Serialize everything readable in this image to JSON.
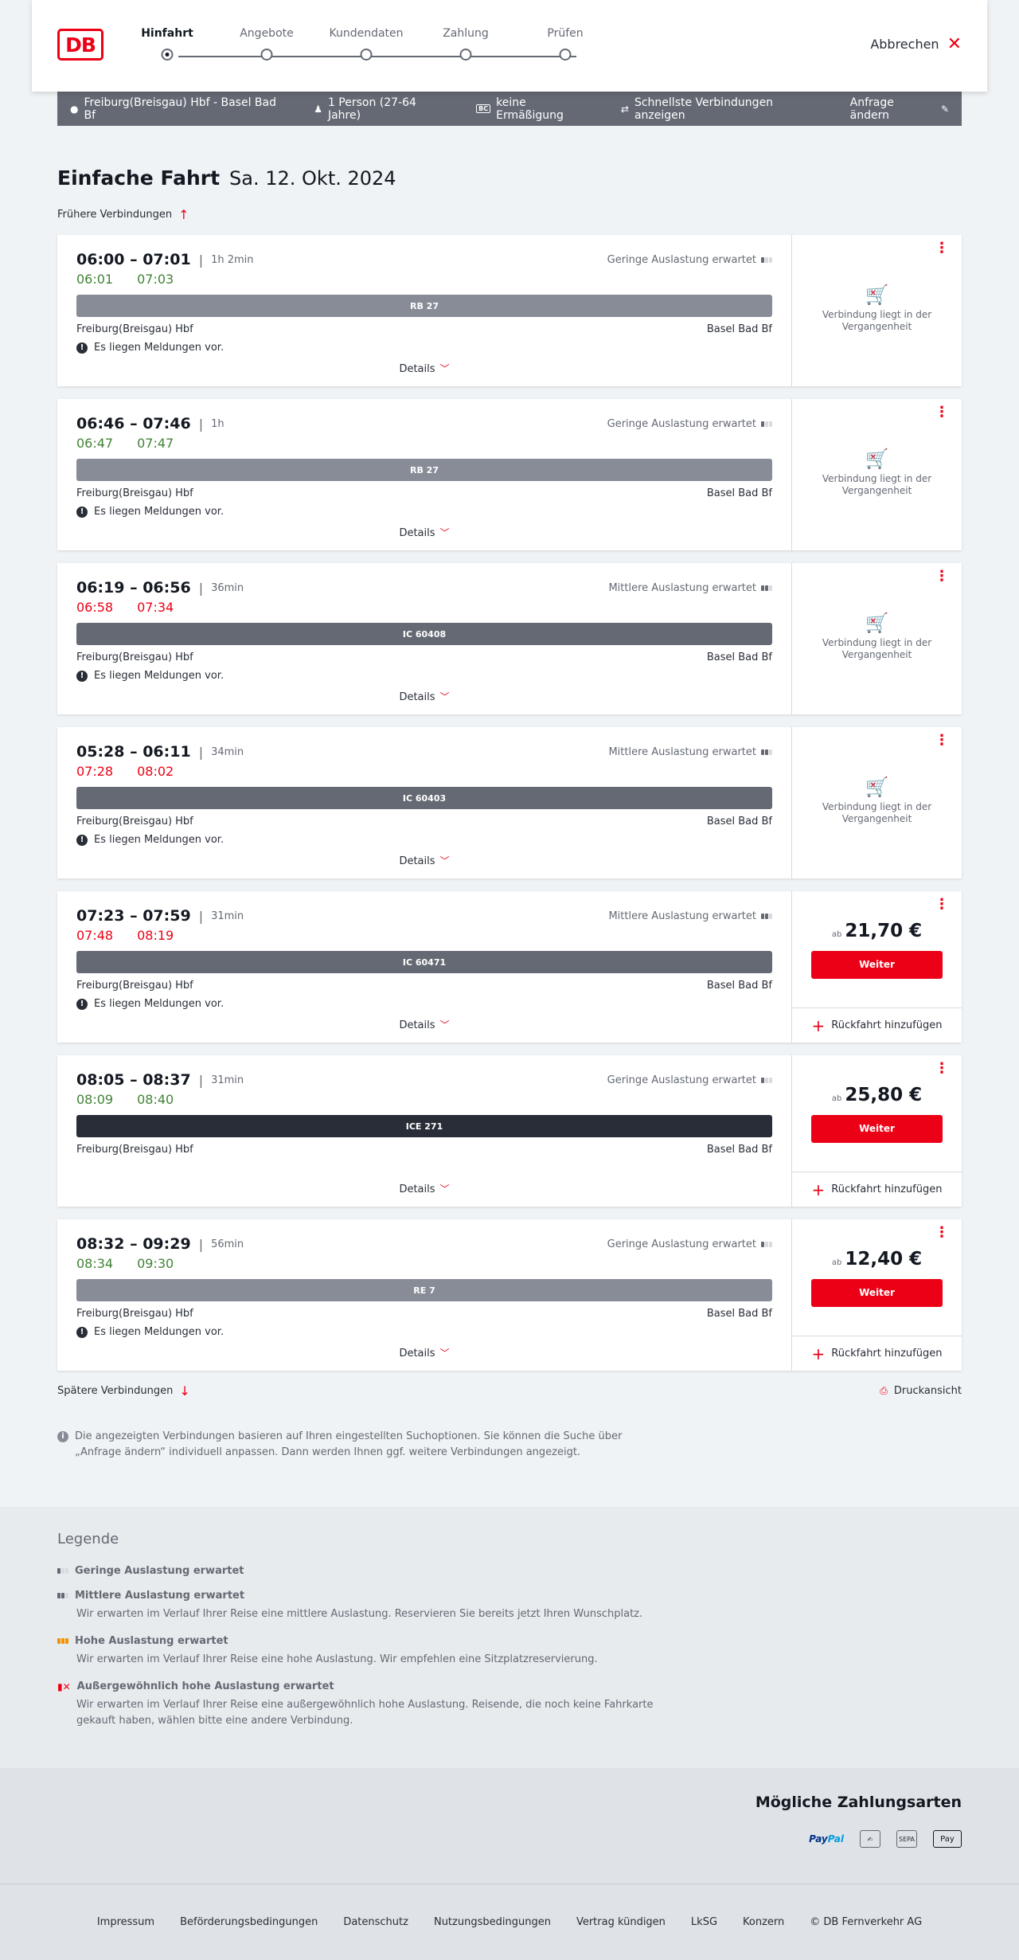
{
  "header": {
    "logo": "DB",
    "steps": [
      {
        "label": "Hinfahrt",
        "active": true
      },
      {
        "label": "Angebote",
        "active": false
      },
      {
        "label": "Kundendaten",
        "active": false
      },
      {
        "label": "Zahlung",
        "active": false
      },
      {
        "label": "Prüfen",
        "active": false
      }
    ],
    "cancel_label": "Abbrechen"
  },
  "searchbar": {
    "route": "Freiburg(Breisgau) Hbf - Basel Bad Bf",
    "persons": "1 Person (27-64 Jahre)",
    "discount_badge": "BC",
    "discount": "keine Ermäßigung",
    "fastest": "Schnellste Verbindungen anzeigen",
    "change": "Anfrage ändern"
  },
  "page": {
    "title": "Einfache Fahrt",
    "date": "Sa. 12. Okt. 2024",
    "earlier": "Frühere Verbindungen",
    "later": "Spätere Verbindungen",
    "print": "Druckansicht",
    "info": "Die angezeigten Verbindungen basieren auf Ihren eingestellten Suchoptionen. Sie können die Suche über „Anfrage ändern“ individuell anpassen. Dann werden Ihnen ggf. weitere Verbindungen angezeigt."
  },
  "connections": [
    {
      "times": "06:00 – 07:01",
      "duration": "1h 2min",
      "load": "Geringe Auslastung erwartet",
      "load_level": 1,
      "rt_dep": "06:01",
      "rt_arr": "07:03",
      "rt_status": "ok",
      "train": "RB 27",
      "train_color": "#878c96",
      "from": "Freiburg(Breisgau) Hbf",
      "to": "Basel Bad Bf",
      "message": "Es liegen Meldungen vor.",
      "details": "Details",
      "past": "Verbindung liegt in der Vergangenheit"
    },
    {
      "times": "06:46 – 07:46",
      "duration": "1h",
      "load": "Geringe Auslastung erwartet",
      "load_level": 1,
      "rt_dep": "06:47",
      "rt_arr": "07:47",
      "rt_status": "ok",
      "train": "RB 27",
      "train_color": "#878c96",
      "from": "Freiburg(Breisgau) Hbf",
      "to": "Basel Bad Bf",
      "message": "Es liegen Meldungen vor.",
      "details": "Details",
      "past": "Verbindung liegt in der Vergangenheit"
    },
    {
      "times": "06:19 – 06:56",
      "duration": "36min",
      "load": "Mittlere Auslastung erwartet",
      "load_level": 2,
      "rt_dep": "06:58",
      "rt_arr": "07:34",
      "rt_status": "late",
      "train": "IC 60408",
      "train_color": "#646973",
      "from": "Freiburg(Breisgau) Hbf",
      "to": "Basel Bad Bf",
      "message": "Es liegen Meldungen vor.",
      "details": "Details",
      "past": "Verbindung liegt in der Vergangenheit"
    },
    {
      "times": "05:28 – 06:11",
      "duration": "34min",
      "load": "Mittlere Auslastung erwartet",
      "load_level": 2,
      "rt_dep": "07:28",
      "rt_arr": "08:02",
      "rt_status": "late",
      "train": "IC 60403",
      "train_color": "#646973",
      "from": "Freiburg(Breisgau) Hbf",
      "to": "Basel Bad Bf",
      "message": "Es liegen Meldungen vor.",
      "details": "Details",
      "past": "Verbindung liegt in der Vergangenheit"
    },
    {
      "times": "07:23 – 07:59",
      "duration": "31min",
      "load": "Mittlere Auslastung erwartet",
      "load_level": 2,
      "rt_dep": "07:48",
      "rt_arr": "08:19",
      "rt_status": "late",
      "train": "IC 60471",
      "train_color": "#646973",
      "from": "Freiburg(Breisgau) Hbf",
      "to": "Basel Bad Bf",
      "message": "Es liegen Meldungen vor.",
      "details": "Details",
      "price_ab": "ab",
      "price": "21,70 €",
      "weiter": "Weiter",
      "return": "Rückfahrt hinzufügen"
    },
    {
      "times": "08:05 – 08:37",
      "duration": "31min",
      "load": "Geringe Auslastung erwartet",
      "load_level": 1,
      "rt_dep": "08:09",
      "rt_arr": "08:40",
      "rt_status": "ok",
      "train": "ICE 271",
      "train_color": "#282d37",
      "from": "Freiburg(Breisgau) Hbf",
      "to": "Basel Bad Bf",
      "message": "",
      "details": "Details",
      "price_ab": "ab",
      "price": "25,80 €",
      "weiter": "Weiter",
      "return": "Rückfahrt hinzufügen"
    },
    {
      "times": "08:32 – 09:29",
      "duration": "56min",
      "load": "Geringe Auslastung erwartet",
      "load_level": 1,
      "rt_dep": "08:34",
      "rt_arr": "09:30",
      "rt_status": "ok",
      "train": "RE 7",
      "train_color": "#878c96",
      "from": "Freiburg(Breisgau) Hbf",
      "to": "Basel Bad Bf",
      "message": "Es liegen Meldungen vor.",
      "details": "Details",
      "price_ab": "ab",
      "price": "12,40 €",
      "weiter": "Weiter",
      "return": "Rückfahrt hinzufügen"
    }
  ],
  "legend": {
    "title": "Legende",
    "items": [
      {
        "title": "Geringe Auslastung erwartet",
        "text": ""
      },
      {
        "title": "Mittlere Auslastung erwartet",
        "text": "Wir erwarten im Verlauf Ihrer Reise eine mittlere Auslastung. Reservieren Sie bereits jetzt Ihren Wunschplatz."
      },
      {
        "title": "Hohe Auslastung erwartet",
        "text": "Wir erwarten im Verlauf Ihrer Reise eine hohe Auslastung. Wir empfehlen eine Sitzplatzreservierung."
      },
      {
        "title": "Außergewöhnlich hohe Auslastung erwartet",
        "text": "Wir erwarten im Verlauf Ihrer Reise eine außergewöhnlich hohe Auslastung. Reisende, die noch keine Fahrkarte gekauft haben, wählen bitte eine andere Verbindung."
      }
    ]
  },
  "payment": {
    "title": "Mögliche Zahlungsarten",
    "paypal_a": "Pay",
    "paypal_b": "Pal",
    "sepa": "SEPA",
    "applepay": "Pay"
  },
  "footer": [
    "Impressum",
    "Beförderungsbedingungen",
    "Datenschutz",
    "Nutzungsbedingungen",
    "Vertrag kündigen",
    "LkSG",
    "Konzern",
    "© DB Fernverkehr AG"
  ]
}
